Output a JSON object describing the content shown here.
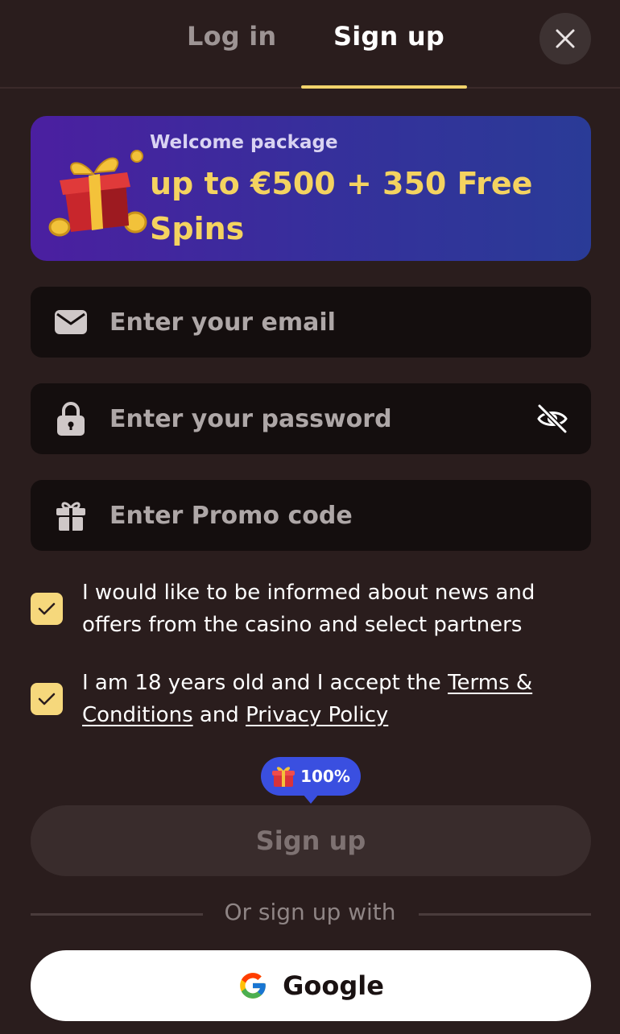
{
  "tabs": {
    "login_label": "Log in",
    "signup_label": "Sign up"
  },
  "banner": {
    "kicker": "Welcome package",
    "title": "up to €500 + 350 Free Spins"
  },
  "fields": {
    "email_placeholder": "Enter your email",
    "password_placeholder": "Enter your password",
    "promo_placeholder": "Enter Promo code"
  },
  "consents": {
    "news_text": "I would like to be informed about news and offers from the casino and select partners",
    "age_prefix": "I am 18 years old and I accept the ",
    "terms_link": "Terms & Conditions",
    "and_text": " and ",
    "privacy_link": "Privacy Policy",
    "news_checked": true,
    "age_checked": true
  },
  "bonus_bubble": {
    "label": "100%"
  },
  "actions": {
    "signup_label": "Sign up",
    "divider_text": "Or sign up with",
    "google_label": "Google"
  },
  "colors": {
    "background": "#2a1d1d",
    "accent": "#f6d87c",
    "banner_title": "#f4d360",
    "bubble": "#3a4fe0"
  },
  "icons": {
    "close": "close-icon",
    "email": "envelope-icon",
    "password": "lock-icon",
    "eye": "eye-off-icon",
    "promo": "gift-icon",
    "google": "google-logo-icon"
  }
}
